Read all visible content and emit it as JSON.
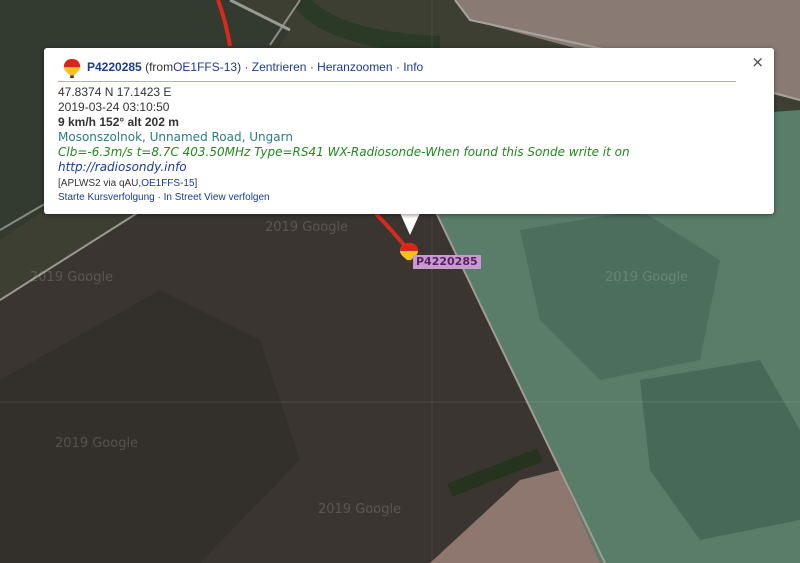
{
  "map": {
    "watermarks": [
      "2019 Google",
      "2019 Google",
      "2019 Google",
      "2019 Google",
      "2019 Google"
    ]
  },
  "marker": {
    "label": "P4220285",
    "icon": "balloon-icon"
  },
  "popup": {
    "icon": "balloon-icon",
    "callsign": "P4220285",
    "from_prefix": "(from",
    "from_station": "OE1FFS-13",
    "from_suffix": ")",
    "separator": " · ",
    "links": [
      "Zentrieren",
      "Heranzoomen",
      "Info"
    ],
    "close_label": "×",
    "coords": "47.8374 N 17.1423 E",
    "timestamp": "2019-03-24 03:10:50",
    "speed_course_alt": "9 km/h 152° alt 202 m",
    "location": "Mosonszolnok, Unnamed Road, Ungarn",
    "comment": "Clb=-6.3m/s t=8.7C 403.50MHz Type=RS41 WX-Radiosonde-When found this Sonde write it on",
    "comment_url": "http://radiosondy.info",
    "path_prefix": "[APLWS2 via qAU,",
    "path_station": "OE1FFS-15",
    "path_suffix": "]",
    "track_links": [
      "Starte Kursverfolgung",
      "In Street View verfolgen"
    ]
  },
  "colors": {
    "track": "#d62a1c",
    "label_bg": "#c59ccc",
    "link": "#1a3a99",
    "location": "#2a7d84",
    "comment": "#22891c"
  }
}
